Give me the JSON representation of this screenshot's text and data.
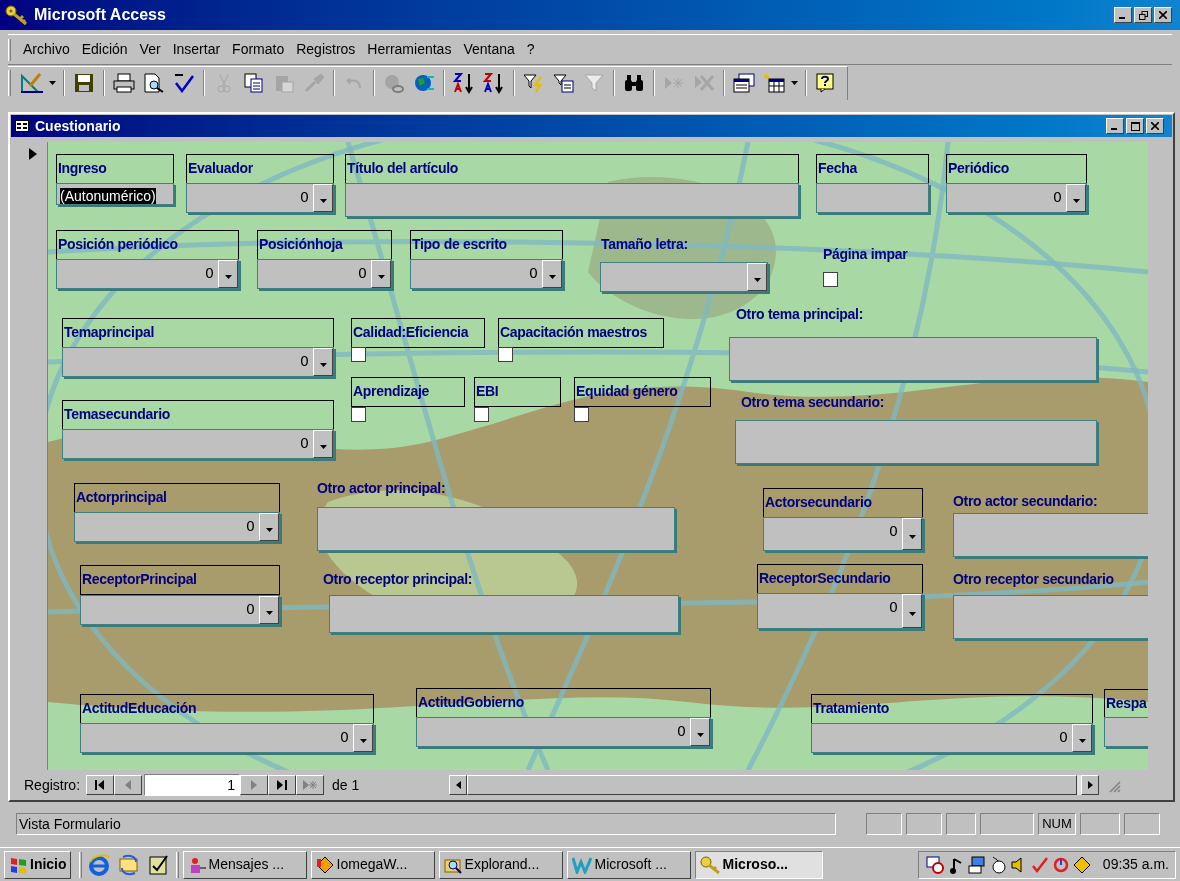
{
  "app_window": {
    "title": "Microsoft Access"
  },
  "menu": [
    "Archivo",
    "Edición",
    "Ver",
    "Insertar",
    "Formato",
    "Registros",
    "Herramientas",
    "Ventana",
    "?"
  ],
  "toolbar": [
    {
      "kind": "view",
      "disabled": false
    },
    {
      "kind": "dropdown",
      "disabled": false
    },
    {
      "kind": "sep"
    },
    {
      "kind": "save",
      "disabled": false
    },
    {
      "kind": "sep"
    },
    {
      "kind": "print",
      "disabled": false
    },
    {
      "kind": "preview",
      "disabled": false
    },
    {
      "kind": "spell",
      "disabled": false
    },
    {
      "kind": "sep"
    },
    {
      "kind": "cut",
      "disabled": true
    },
    {
      "kind": "copy",
      "disabled": false
    },
    {
      "kind": "paste",
      "disabled": true
    },
    {
      "kind": "brush",
      "disabled": true
    },
    {
      "kind": "sep"
    },
    {
      "kind": "undo",
      "disabled": true
    },
    {
      "kind": "sep"
    },
    {
      "kind": "link",
      "disabled": true
    },
    {
      "kind": "web",
      "disabled": false
    },
    {
      "kind": "sep"
    },
    {
      "kind": "sortasc",
      "disabled": false
    },
    {
      "kind": "sortdesc",
      "disabled": false
    },
    {
      "kind": "sep"
    },
    {
      "kind": "filtersel",
      "disabled": false
    },
    {
      "kind": "filterform",
      "disabled": false
    },
    {
      "kind": "filter",
      "disabled": true
    },
    {
      "kind": "sep"
    },
    {
      "kind": "find",
      "disabled": false
    },
    {
      "kind": "sep"
    },
    {
      "kind": "newrec",
      "disabled": true
    },
    {
      "kind": "delrec",
      "disabled": true
    },
    {
      "kind": "sep"
    },
    {
      "kind": "dbwin",
      "disabled": false
    },
    {
      "kind": "newobj",
      "disabled": false
    },
    {
      "kind": "dropdown",
      "disabled": false
    },
    {
      "kind": "sep"
    },
    {
      "kind": "help",
      "disabled": false
    }
  ],
  "form_window": {
    "title": "Cuestionario"
  },
  "controls": [
    {
      "kind": "text",
      "label": "Ingreso",
      "label_boxed": true,
      "value": "(Autonumérico)",
      "focused": true
    },
    {
      "kind": "combo",
      "label": "Evaluador",
      "label_boxed": true,
      "value": "0"
    },
    {
      "kind": "text",
      "label": "Título del artículo",
      "label_boxed": true,
      "focused": false
    },
    {
      "kind": "text",
      "label": "Fecha",
      "label_boxed": true,
      "focused": false
    },
    {
      "kind": "combo",
      "label": "Periódico",
      "label_boxed": true,
      "value": "0"
    },
    {
      "kind": "combo",
      "label": "Posición periódico",
      "label_boxed": true,
      "value": "0"
    },
    {
      "kind": "combo",
      "label": "Posiciónhoja",
      "label_boxed": true,
      "value": "0"
    },
    {
      "kind": "combo",
      "label": "Tipo de escrito",
      "label_boxed": true,
      "value": "0"
    },
    {
      "kind": "combo",
      "label": "Tamaño letra:",
      "label_boxed": false
    },
    {
      "kind": "checkbox",
      "label": "Página impar",
      "label_boxed": false,
      "checked": false
    },
    {
      "kind": "combo",
      "label": "Temaprincipal",
      "label_boxed": true,
      "value": "0"
    },
    {
      "kind": "checkbox",
      "label": "Calidad:Eficiencia",
      "label_boxed": true,
      "checked": false
    },
    {
      "kind": "checkbox",
      "label": "Capacitación maestros",
      "label_boxed": true,
      "checked": false
    },
    {
      "kind": "text",
      "label": "Otro tema principal:",
      "label_boxed": false,
      "focused": false
    },
    {
      "kind": "checkbox",
      "label": "Aprendizaje",
      "label_boxed": true,
      "checked": false
    },
    {
      "kind": "checkbox",
      "label": "EBI",
      "label_boxed": true,
      "checked": false
    },
    {
      "kind": "checkbox",
      "label": "Equidad género",
      "label_boxed": true,
      "checked": false
    },
    {
      "kind": "combo",
      "label": "Temasecundario",
      "label_boxed": true,
      "value": "0"
    },
    {
      "kind": "text",
      "label": "Otro tema secundario:",
      "label_boxed": false,
      "focused": false
    },
    {
      "kind": "combo",
      "label": "Actorprincipal",
      "label_boxed": true,
      "value": "0"
    },
    {
      "kind": "text",
      "label": "Otro actor principal:",
      "label_boxed": false,
      "focused": false
    },
    {
      "kind": "combo",
      "label": "Actorsecundario",
      "label_boxed": true,
      "value": "0"
    },
    {
      "kind": "text",
      "label": "Otro actor secundario:",
      "label_boxed": false,
      "focused": false
    },
    {
      "kind": "combo",
      "label": "ReceptorPrincipal",
      "label_boxed": true,
      "value": "0"
    },
    {
      "kind": "text",
      "label": "Otro receptor principal:",
      "label_boxed": false,
      "focused": false
    },
    {
      "kind": "combo",
      "label": "ReceptorSecundario",
      "label_boxed": true,
      "value": "0"
    },
    {
      "kind": "text",
      "label": "Otro receptor secundario",
      "label_boxed": false,
      "focused": false
    },
    {
      "kind": "combo",
      "label": "ActitudEducación",
      "label_boxed": true,
      "value": "0"
    },
    {
      "kind": "combo",
      "label": "ActitudGobierno",
      "label_boxed": true,
      "value": "0"
    },
    {
      "kind": "combo",
      "label": "Tratamiento",
      "label_boxed": true,
      "value": "0"
    },
    {
      "kind": "text",
      "label": "Respa",
      "label_boxed": true,
      "focused": false
    }
  ],
  "navigation": {
    "label": "Registro:",
    "record": "1",
    "total": "de 1"
  },
  "status_bar": {
    "text": "Vista Formulario",
    "indicator": "NUM"
  },
  "taskbar": {
    "start": "Inicio",
    "tasks": [
      {
        "kind": "mail",
        "label": "Mensajes ...",
        "selected": false
      },
      {
        "kind": "iomega",
        "label": "IomegaW...",
        "selected": false
      },
      {
        "kind": "explorer",
        "label": "Explorand...",
        "selected": false
      },
      {
        "kind": "word",
        "label": "Microsoft ...",
        "selected": false
      },
      {
        "kind": "access",
        "label": "Microso...",
        "selected": true
      }
    ],
    "clock": "09:35 a.m."
  }
}
